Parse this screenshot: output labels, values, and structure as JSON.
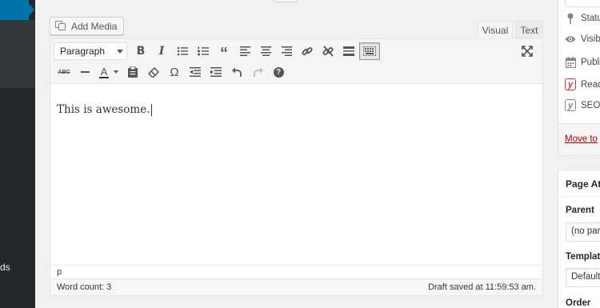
{
  "sidebar": {
    "fragment_label": "ds"
  },
  "toolbar": {
    "add_media_label": "Add Media",
    "format_select_value": "Paragraph",
    "tabs": [
      {
        "label": "Visual"
      },
      {
        "label": "Text"
      }
    ]
  },
  "editor": {
    "content_text": "This is awesome.",
    "path_text": "p",
    "word_count_text": "Word count: 3",
    "draft_saved_text": "Draft saved at 11:59:53 am."
  },
  "publish": {
    "rows": [
      {
        "label": "Status",
        "icon": "pin-icon"
      },
      {
        "label": "Visib",
        "icon": "eye-icon"
      },
      {
        "label": "Publi",
        "icon": "calendar-icon"
      },
      {
        "label": "Read",
        "icon": "yoast-icon",
        "color": "#dc3232"
      },
      {
        "label": "SEO:",
        "icon": "yoast-icon",
        "color": "#82878c"
      }
    ],
    "move_to_trash_label": "Move to"
  },
  "page_attributes": {
    "title": "Page Att",
    "parent_label": "Parent",
    "parent_value": "(no par",
    "template_label": "Template",
    "template_value": "Default",
    "order_label": "Order"
  },
  "colors": {
    "accent": "#0073aa",
    "sidebar_bg": "#23282d",
    "trash": "#a00000",
    "yoast_red": "#dc3232"
  }
}
